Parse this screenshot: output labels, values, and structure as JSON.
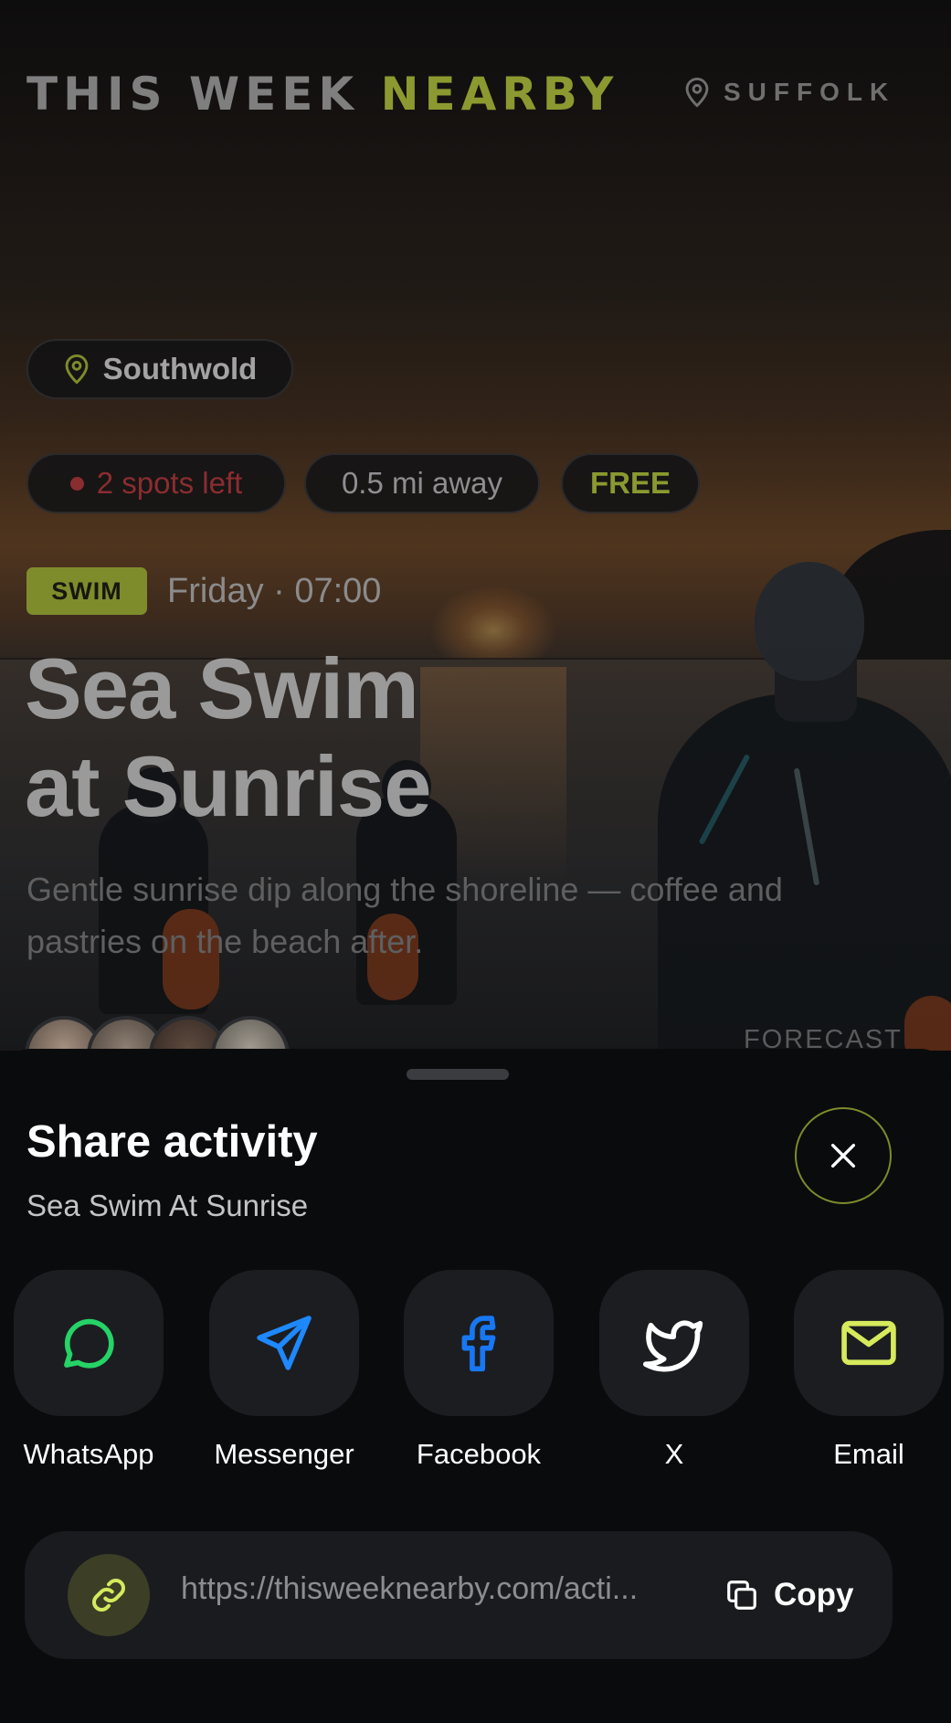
{
  "header": {
    "brand_left": "THIS WEEK",
    "brand_right": "NEARBY",
    "region": "SUFFOLK",
    "region_icon": "map-pin-icon"
  },
  "activity": {
    "location": "Southwold",
    "location_icon": "map-pin-icon",
    "spots_left": "2 spots left",
    "distance": "0.5 mi away",
    "price": "FREE",
    "category": "SWIM",
    "when": "Friday · 07:00",
    "title_line1": "Sea Swim",
    "title_line2": "at Sunrise",
    "description": "Gentle sunrise dip along the shoreline — coffee and pastries on the beach after.",
    "forecast_label": "FORECAST"
  },
  "share_sheet": {
    "title": "Share activity",
    "subtitle": "Sea Swim At Sunrise",
    "close_icon": "close-icon",
    "options": [
      {
        "label": "WhatsApp",
        "icon": "whatsapp-icon",
        "color": "#25d366"
      },
      {
        "label": "Messenger",
        "icon": "messenger-icon",
        "color": "#1e88ff"
      },
      {
        "label": "Facebook",
        "icon": "facebook-icon",
        "color": "#1877f2"
      },
      {
        "label": "X",
        "icon": "x-icon",
        "color": "#ffffff"
      },
      {
        "label": "Email",
        "icon": "email-icon",
        "color": "#d6ea5c"
      }
    ],
    "link": {
      "url": "https://thisweeknearby.com/acti...",
      "copy_label": "Copy",
      "link_icon": "link-icon",
      "copy_icon": "copy-icon"
    }
  },
  "colors": {
    "accent": "#c8dc4a",
    "alert": "#e0454a",
    "sheet_background": "#0a0b0d",
    "tile_background": "#1c1d21"
  }
}
